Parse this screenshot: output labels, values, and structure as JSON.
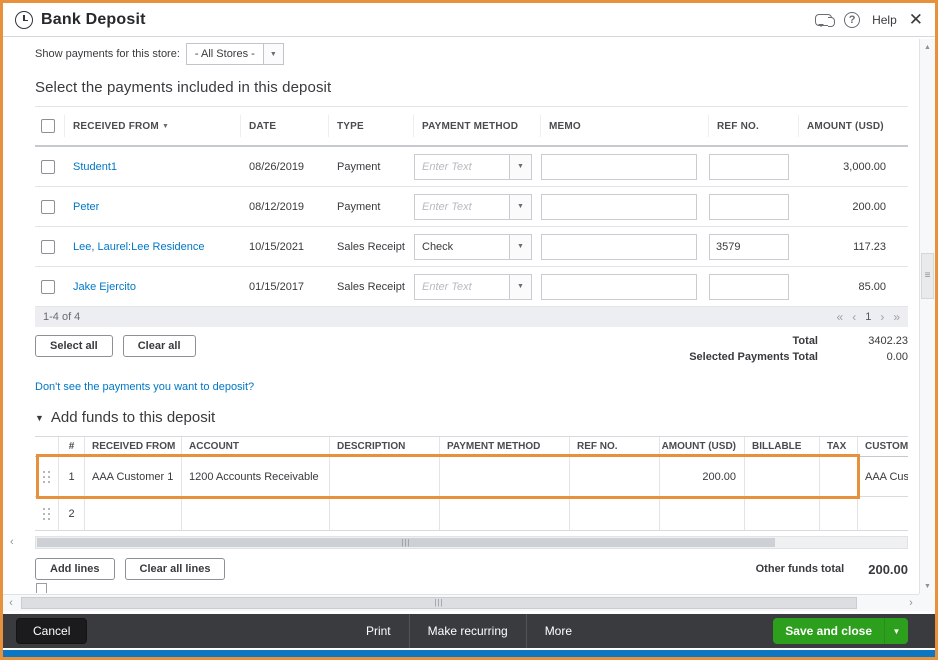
{
  "header": {
    "title": "Bank Deposit",
    "help_label": "Help"
  },
  "store_filter": {
    "label": "Show payments for this store:",
    "value": "- All Stores -"
  },
  "payments": {
    "section_title": "Select the payments included in this deposit",
    "columns": [
      "RECEIVED FROM",
      "DATE",
      "TYPE",
      "PAYMENT METHOD",
      "MEMO",
      "REF NO.",
      "AMOUNT (USD)"
    ],
    "rows": [
      {
        "received_from": "Student1",
        "date": "08/26/2019",
        "type": "Payment",
        "method_display": "Enter Text",
        "memo": "",
        "ref_no": "",
        "amount": "3,000.00"
      },
      {
        "received_from": "Peter",
        "date": "08/12/2019",
        "type": "Payment",
        "method_display": "Enter Text",
        "memo": "",
        "ref_no": "",
        "amount": "200.00"
      },
      {
        "received_from": "Lee, Laurel:Lee Residence",
        "date": "10/15/2021",
        "type": "Sales Receipt",
        "method_display": "Check",
        "memo": "",
        "ref_no": "3579",
        "amount": "117.23"
      },
      {
        "received_from": "Jake Ejercito",
        "date": "01/15/2017",
        "type": "Sales Receipt",
        "method_display": "Enter Text",
        "memo": "",
        "ref_no": "",
        "amount": "85.00"
      }
    ],
    "pagination": {
      "range": "1-4 of 4",
      "page": "1"
    },
    "select_all_label": "Select all",
    "clear_all_label": "Clear all",
    "total_label": "Total",
    "total_value": "3402.23",
    "selected_label": "Selected Payments Total",
    "selected_value": "0.00",
    "link": "Don't see the payments you want to deposit?"
  },
  "add_funds": {
    "section_title": "Add funds to this deposit",
    "columns": [
      "#",
      "RECEIVED FROM",
      "ACCOUNT",
      "DESCRIPTION",
      "PAYMENT METHOD",
      "REF NO.",
      "AMOUNT (USD)",
      "BILLABLE",
      "TAX",
      "CUSTOMER"
    ],
    "rows": [
      {
        "num": "1",
        "received_from": "AAA Customer 1",
        "account": "1200 Accounts Receivable",
        "description": "",
        "payment_method": "",
        "ref_no": "",
        "amount": "200.00",
        "billable": "",
        "tax": "",
        "customer": "AAA Cust"
      },
      {
        "num": "2",
        "received_from": "",
        "account": "",
        "description": "",
        "payment_method": "",
        "ref_no": "",
        "amount": "",
        "billable": "",
        "tax": "",
        "customer": ""
      }
    ],
    "add_lines_label": "Add lines",
    "clear_all_lines_label": "Clear all lines",
    "other_total_label": "Other funds total",
    "other_total_value": "200.00"
  },
  "footer": {
    "cancel_label": "Cancel",
    "print_label": "Print",
    "make_recurring_label": "Make recurring",
    "more_label": "More",
    "save_label": "Save and close"
  },
  "icons": {
    "caret_down": "▼",
    "sort_down": "▼",
    "collapse_triangle": "▼",
    "help_q": "?",
    "close": "✕",
    "pager_first": "«",
    "pager_prev": "‹",
    "pager_next": "›",
    "pager_last": "»",
    "arrow_up": "▲",
    "arrow_down": "▼",
    "arrow_left": "‹",
    "arrow_right": "›",
    "grip_v": "≡",
    "grip_h": "|||"
  },
  "colors": {
    "accent_orange": "#E8913D",
    "link_blue": "#0077C5",
    "save_green": "#2CA01C",
    "footer_dark": "#3A3B3F",
    "bottom_strip_blue": "#0D76C2"
  }
}
